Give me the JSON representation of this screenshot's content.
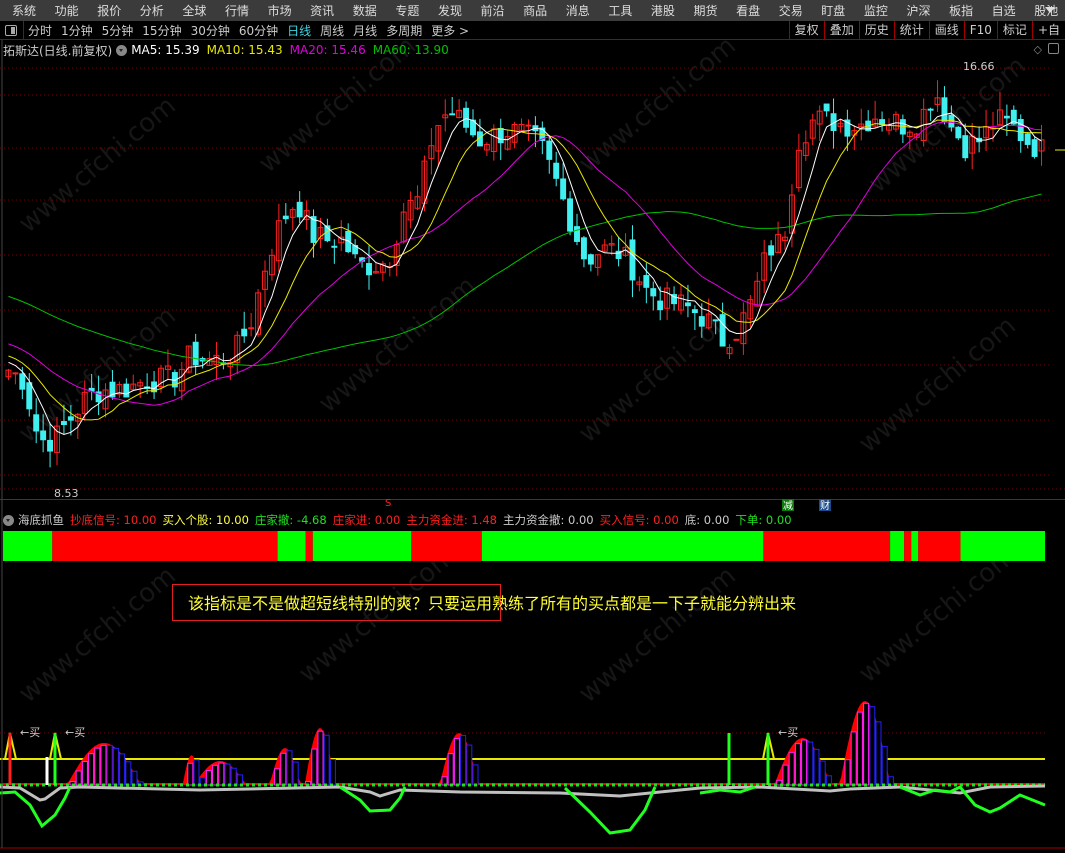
{
  "menu": [
    "系统",
    "功能",
    "报价",
    "分析",
    "全球",
    "行情",
    "市场",
    "资讯",
    "数据",
    "专题",
    "发现",
    "前沿",
    "商品",
    "消息",
    "工具",
    "港股",
    "期货",
    "看盘",
    "交易",
    "盯盘",
    "监控",
    "沪深",
    "板指",
    "自选",
    "股池"
  ],
  "toolbar": {
    "periods": [
      "分时",
      "1分钟",
      "5分钟",
      "15分钟",
      "30分钟",
      "60分钟",
      "日线",
      "周线",
      "月线",
      "多周期",
      "更多 >"
    ],
    "active_period": "日线",
    "tools": [
      "复权",
      "叠加",
      "历史",
      "统计",
      "画线",
      "F10",
      "标记",
      "+自"
    ]
  },
  "info": {
    "stock": "拓斯达(日线.前复权)",
    "ma5": "MA5: 15.39",
    "ma10": "MA10: 15.43",
    "ma20": "MA20: 15.46",
    "ma60": "MA60: 13.90"
  },
  "colors": {
    "ma5": "#ffffff",
    "ma10": "#e8e800",
    "ma20": "#e000e0",
    "ma60": "#00c000",
    "up": "#ff2020",
    "down": "#40f0f0",
    "buy_bar": "#00ff00",
    "sell_bar": "#ff0000"
  },
  "chart": {
    "high_label": "16.66",
    "low_label": "8.53",
    "closes": [
      10.83,
      10.64,
      9.5,
      9.5,
      9.88,
      10.26,
      10.45,
      10.45,
      10.5,
      10.64,
      10.64,
      10.7,
      11.11,
      11.02,
      11.02,
      11.21,
      11.78,
      12.92,
      13.68,
      14.06,
      13.39,
      13.3,
      13.3,
      12.82,
      12.82,
      12.9,
      13.87,
      14.06,
      15.39,
      15.77,
      15.5,
      15.2,
      15.29,
      15.39,
      15.29,
      15.1,
      14.44,
      13.68,
      12.92,
      13.11,
      13.11,
      12.82,
      12.35,
      12.16,
      12.1,
      11.97,
      11.78,
      11.4,
      11.6,
      12.16,
      13.11,
      13.3,
      15.2,
      15.58,
      15.58,
      15.5,
      15.48,
      15.67,
      15.58,
      15.48,
      15.58,
      16.15,
      15.48,
      15.1,
      15.2,
      15.58,
      15.48,
      15.2,
      15.01
    ],
    "markers": {
      "s": "S",
      "reduce": "减",
      "finance": "财"
    }
  },
  "indicator": {
    "name": "海底抓鱼",
    "fields": [
      {
        "label": "抄底信号: 10.00",
        "color": "#ff2020"
      },
      {
        "label": "买入个股: 10.00",
        "color": "#ffff40"
      },
      {
        "label": "庄家撤: -4.68",
        "color": "#20e020"
      },
      {
        "label": "庄家进: 0.00",
        "color": "#ff2020"
      },
      {
        "label": "主力资金进: 1.48",
        "color": "#ff2020"
      },
      {
        "label": "主力资金撤: 0.00",
        "color": "#cccccc"
      },
      {
        "label": "买入信号: 0.00",
        "color": "#ff2020"
      },
      {
        "label": "底: 0.00",
        "color": "#cccccc"
      },
      {
        "label": "下单: 0.00",
        "color": "#20e020"
      }
    ],
    "signal_segments": [
      {
        "signal": "buy",
        "bars": 7
      },
      {
        "signal": "sell",
        "bars": 32
      },
      {
        "signal": "buy",
        "bars": 4
      },
      {
        "signal": "sell",
        "bars": 1
      },
      {
        "signal": "buy",
        "bars": 14
      },
      {
        "signal": "sell",
        "bars": 10
      },
      {
        "signal": "buy",
        "bars": 40
      },
      {
        "signal": "sell",
        "bars": 18
      },
      {
        "signal": "buy",
        "bars": 2
      },
      {
        "signal": "sell",
        "bars": 1
      },
      {
        "signal": "buy",
        "bars": 1
      },
      {
        "signal": "sell",
        "bars": 6
      },
      {
        "signal": "buy",
        "bars": 12
      }
    ],
    "buy_label": "买"
  },
  "annotation": "该指标是不是做超短线特别的爽？只要运用熟练了所有的买点都是一下子就能分辨出来",
  "watermark": "www.cfchi.com"
}
